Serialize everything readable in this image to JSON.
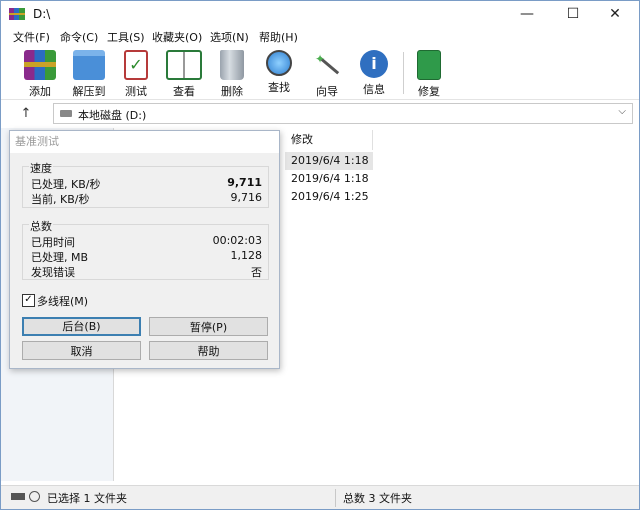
{
  "window": {
    "title": "D:\\",
    "min": "—",
    "max": "☐",
    "close": "✕"
  },
  "menu": [
    "文件(F)",
    "命令(C)",
    "工具(S)",
    "收藏夹(O)",
    "选项(N)",
    "帮助(H)"
  ],
  "toolbar": [
    {
      "label": "添加",
      "icon": "winrar-books-icon"
    },
    {
      "label": "解压到",
      "icon": "folder-icon"
    },
    {
      "label": "测试",
      "icon": "clipboard-check-icon"
    },
    {
      "label": "查看",
      "icon": "book-icon"
    },
    {
      "label": "删除",
      "icon": "trash-icon"
    },
    {
      "label": "查找",
      "icon": "magnifier-icon"
    },
    {
      "label": "向导",
      "icon": "wand-icon"
    },
    {
      "label": "信息",
      "icon": "info-icon"
    },
    {
      "label": "修复",
      "icon": "repair-book-icon"
    }
  ],
  "address": {
    "up": "↑",
    "path": "本地磁盘 (D:)",
    "dropdown": "⌵"
  },
  "list": {
    "column_modified": "修改",
    "rows": [
      "2019/6/4 1:18",
      "2019/6/4 1:18",
      "2019/6/4 1:25"
    ]
  },
  "status": {
    "selected": "已选择 1 文件夹",
    "total": "总数 3 文件夹"
  },
  "dialog": {
    "title": "基准测试",
    "speed_group": "速度",
    "processed_speed_label": "已处理, KB/秒",
    "processed_speed_value": "9,711",
    "current_speed_label": "当前, KB/秒",
    "current_speed_value": "9,716",
    "total_group": "总数",
    "elapsed_label": "已用时间",
    "elapsed_value": "00:02:03",
    "processed_mb_label": "已处理, MB",
    "processed_mb_value": "1,128",
    "errors_label": "发现错误",
    "errors_value": "否",
    "multithread_label": "多线程(M)",
    "multithread_checked": "✓",
    "btn_background": "后台(B)",
    "btn_pause": "暂停(P)",
    "btn_cancel": "取消",
    "btn_help": "帮助"
  },
  "colors": {
    "accent": "#3c7fb1",
    "window_border": "#7a9cc6",
    "selection": "#e5e5e5"
  }
}
